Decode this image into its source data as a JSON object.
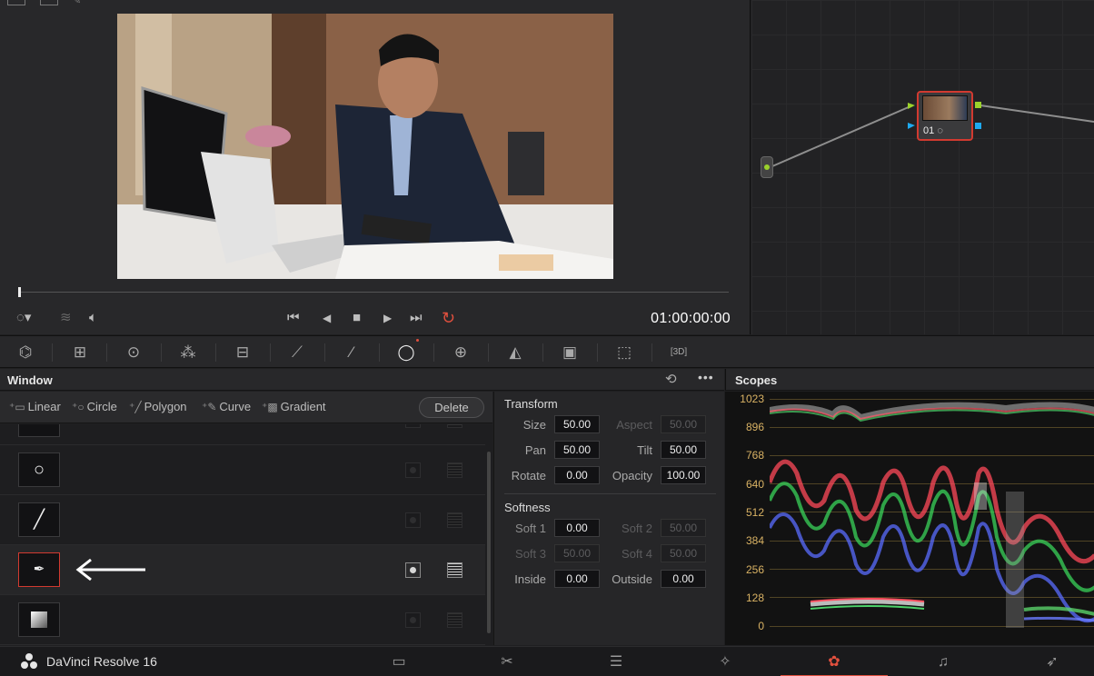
{
  "viewer": {
    "timecode": "01:00:00:00"
  },
  "nodes": {
    "node_label": "01"
  },
  "window_panel": {
    "title": "Window",
    "shapes": [
      {
        "label": "Linear",
        "icon": "linear-window-icon"
      },
      {
        "label": "Circle",
        "icon": "circle-window-icon"
      },
      {
        "label": "Polygon",
        "icon": "polygon-window-icon"
      },
      {
        "label": "Curve",
        "icon": "curve-window-icon"
      },
      {
        "label": "Gradient",
        "icon": "gradient-window-icon"
      }
    ],
    "delete_label": "Delete",
    "rows": [
      "linear-window",
      "circle-window",
      "polygon-window",
      "curve-window",
      "gradient-window"
    ],
    "selected_row": "curve-window"
  },
  "transform": {
    "title": "Transform",
    "size_label": "Size",
    "size": "50.00",
    "aspect_label": "Aspect",
    "aspect": "50.00",
    "pan_label": "Pan",
    "pan": "50.00",
    "tilt_label": "Tilt",
    "tilt": "50.00",
    "rotate_label": "Rotate",
    "rotate": "0.00",
    "opacity_label": "Opacity",
    "opacity": "100.00"
  },
  "softness": {
    "title": "Softness",
    "soft1_label": "Soft 1",
    "soft1": "0.00",
    "soft2_label": "Soft 2",
    "soft2": "50.00",
    "soft3_label": "Soft 3",
    "soft3": "50.00",
    "soft4_label": "Soft 4",
    "soft4": "50.00",
    "inside_label": "Inside",
    "inside": "0.00",
    "outside_label": "Outside",
    "outside": "0.00"
  },
  "scopes": {
    "title": "Scopes",
    "ticks": [
      "1023",
      "896",
      "768",
      "640",
      "512",
      "384",
      "256",
      "128",
      "0"
    ],
    "grid_color": "#d9b264"
  },
  "bottom": {
    "app_name": "DaVinci Resolve 16",
    "pages": [
      "media-page-icon",
      "cut-page-icon",
      "edit-page-icon",
      "fusion-page-icon",
      "color-page-icon",
      "fairlight-page-icon",
      "deliver-page-icon"
    ],
    "active_page": "color-page-icon",
    "accent": "#e2503e"
  }
}
